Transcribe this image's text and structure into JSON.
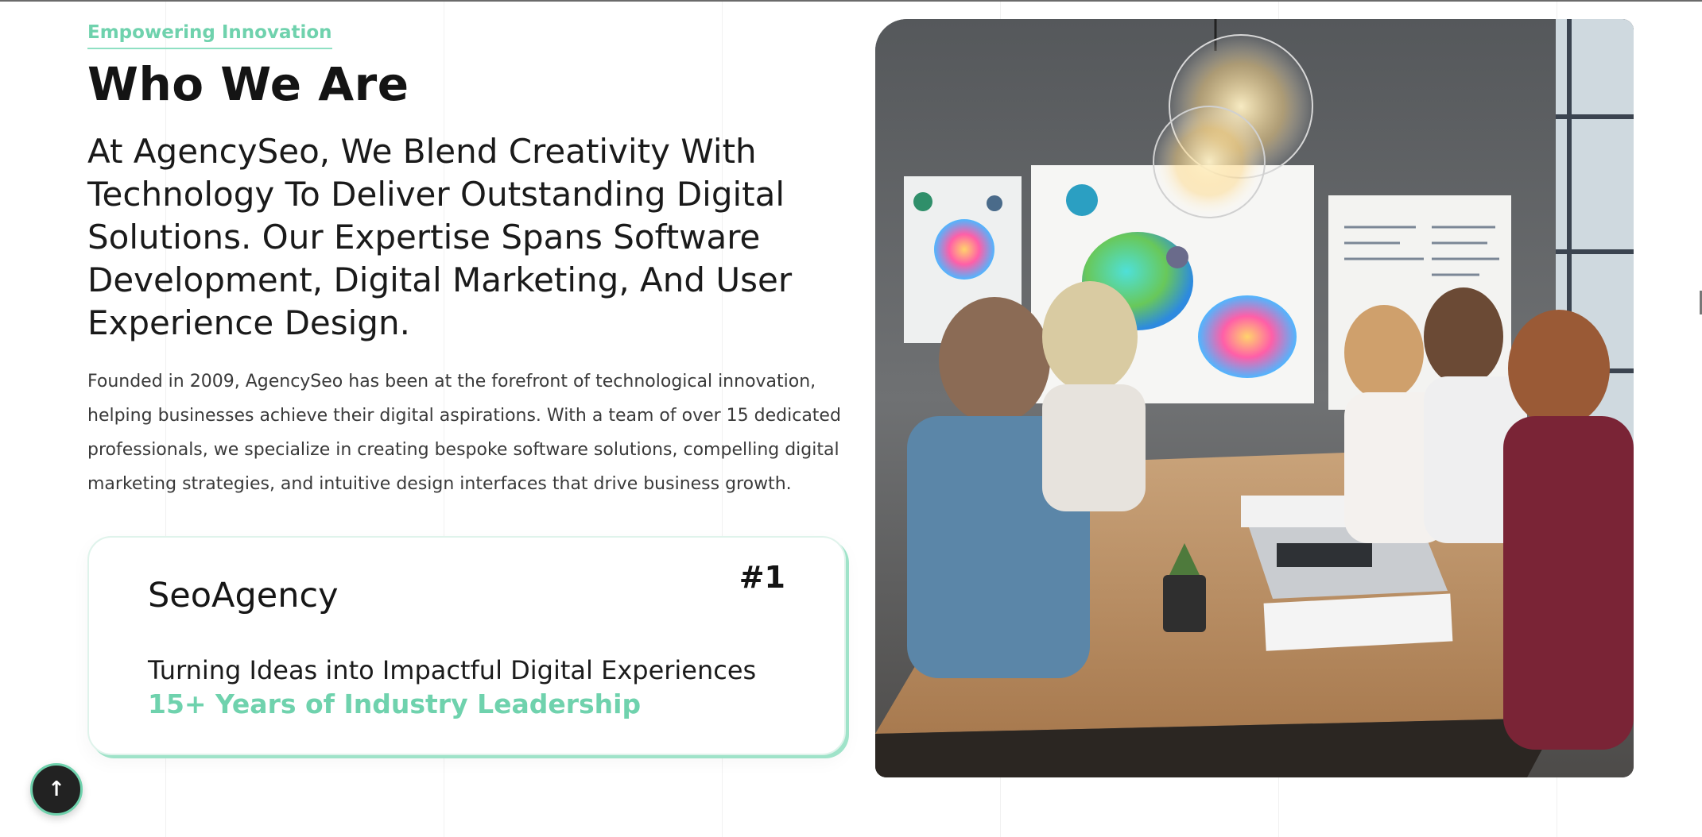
{
  "about": {
    "eyebrow": "Empowering Innovation",
    "title": "Who We Are",
    "lead": "At AgencySeo, We Blend Creativity With Technology To Deliver Outstanding Digital Solutions. Our Expertise Spans Software Development, Digital Marketing, And User Experience Design.",
    "body": "Founded in 2009, AgencySeo has been at the forefront of technological innovation, helping businesses achieve their digital aspirations. With a team of over 15 dedicated professionals, we specialize in creating bespoke software solutions, compelling digital marketing strategies, and intuitive design interfaces that drive business growth."
  },
  "card": {
    "brand": "SeoAgency",
    "rank": "#1",
    "tagline": "Turning Ideas into Impactful Digital Experiences",
    "highlight": "15+ Years of Industry Leadership"
  },
  "scroll_top": {
    "icon": "arrow-up-icon",
    "glyph": "↑"
  },
  "colors": {
    "accent": "#6fd2ad",
    "dark": "#222222",
    "text": "#161616"
  }
}
